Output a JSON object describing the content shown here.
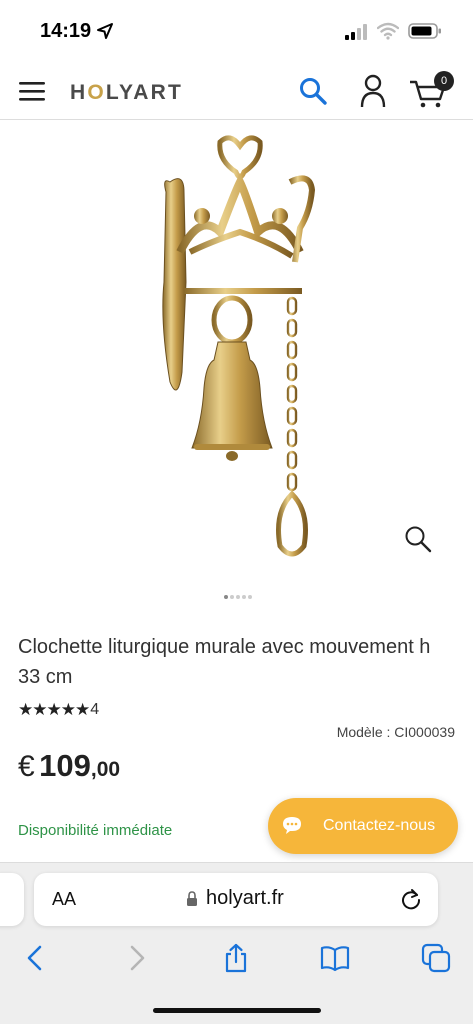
{
  "status_bar": {
    "time": "14:19",
    "icons": [
      "location-arrow-icon",
      "cellular-signal-icon",
      "wifi-icon",
      "battery-icon"
    ]
  },
  "header": {
    "logo_prefix": "H",
    "logo_o": "O",
    "logo_suffix": "LYART",
    "logo_accent_color": "#c8a24a",
    "icons": [
      "menu-icon",
      "search-icon",
      "user-icon",
      "cart-icon"
    ],
    "search_color": "#1a73d9",
    "cart_count": "0"
  },
  "gallery": {
    "image": "wall-mounted liturgical bell in brass",
    "slides_count": 5,
    "active_slide": 1
  },
  "product": {
    "title": "Clochette liturgique murale avec mouvement h 33 cm",
    "rating_stars": "★★★★★",
    "rating_value": 5,
    "review_count": "4",
    "model": "Modèle : CI000039",
    "price_currency": "€",
    "price_integer": "109",
    "price_decimals": ",00",
    "availability": "Disponibilité immédiate",
    "availability_color": "#2e9347"
  },
  "contact": {
    "label": "Contactez-nous",
    "color": "#f6b63a"
  },
  "browser": {
    "aa_label": "AA",
    "domain": "holyart.fr",
    "toolbar": [
      "back-icon",
      "forward-icon",
      "share-icon",
      "bookmarks-icon",
      "tabs-icon"
    ],
    "accent_color": "#1a73d9"
  }
}
